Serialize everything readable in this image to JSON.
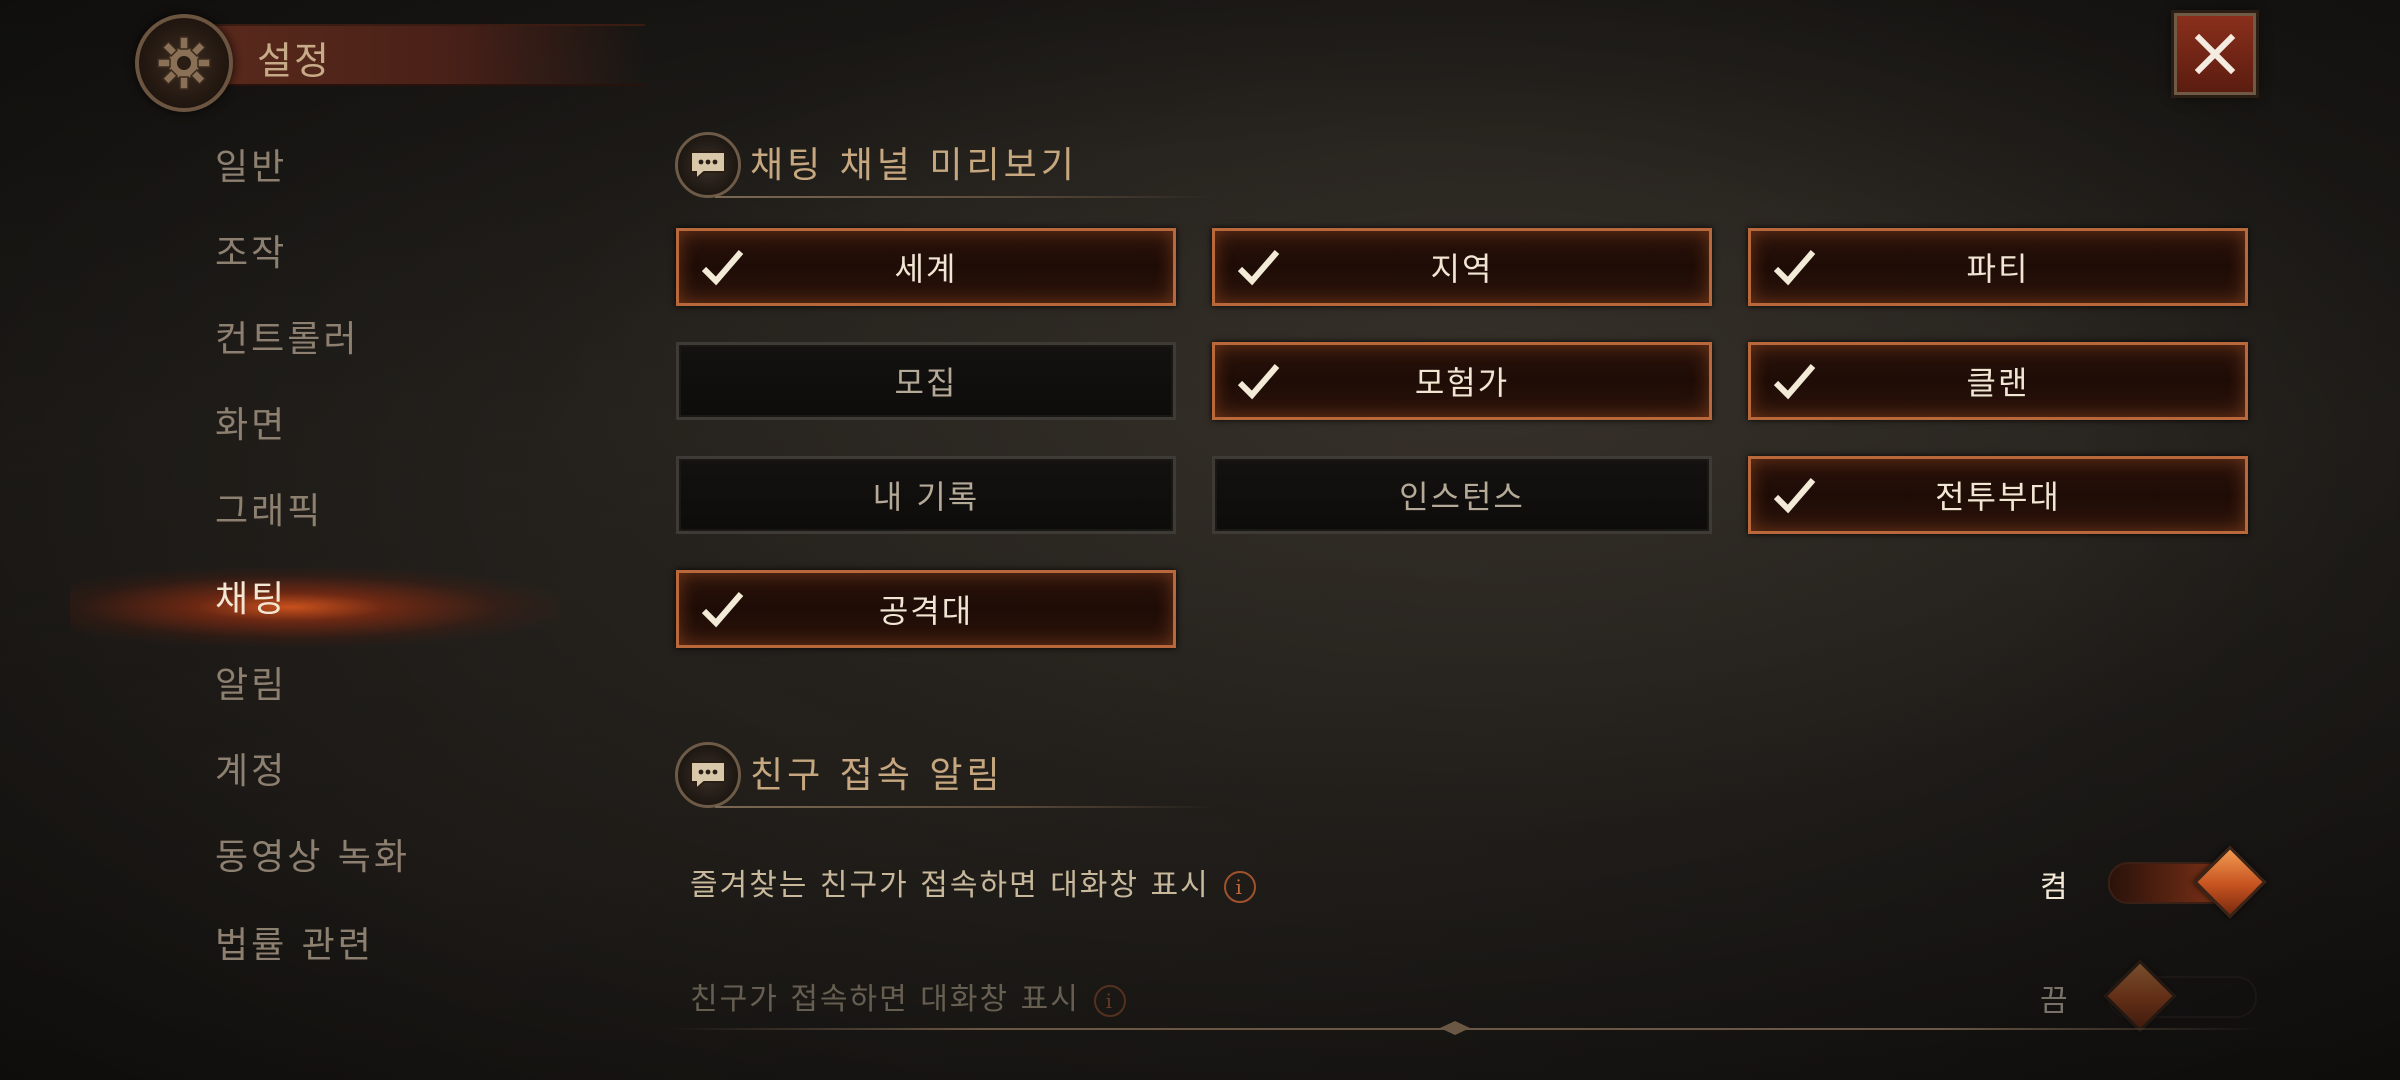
{
  "header": {
    "title": "설정"
  },
  "sidebar": {
    "items": [
      {
        "label": "일반",
        "active": false
      },
      {
        "label": "조작",
        "active": false
      },
      {
        "label": "컨트롤러",
        "active": false
      },
      {
        "label": "화면",
        "active": false
      },
      {
        "label": "그래픽",
        "active": false
      },
      {
        "label": "채팅",
        "active": true
      },
      {
        "label": "알림",
        "active": false
      },
      {
        "label": "계정",
        "active": false
      },
      {
        "label": "동영상 녹화",
        "active": false
      },
      {
        "label": "법률 관련",
        "active": false
      }
    ]
  },
  "chat_preview": {
    "title": "채팅 채널 미리보기",
    "channels": [
      {
        "label": "세계",
        "checked": true
      },
      {
        "label": "지역",
        "checked": true
      },
      {
        "label": "파티",
        "checked": true
      },
      {
        "label": "모집",
        "checked": false
      },
      {
        "label": "모험가",
        "checked": true
      },
      {
        "label": "클랜",
        "checked": true
      },
      {
        "label": "내 기록",
        "checked": false
      },
      {
        "label": "인스턴스",
        "checked": false
      },
      {
        "label": "전투부대",
        "checked": true
      },
      {
        "label": "공격대",
        "checked": true
      }
    ]
  },
  "friend_alert": {
    "title": "친구 접속 알림",
    "rows": [
      {
        "label": "즐겨찾는 친구가 접속하면 대화창 표시",
        "info_icon": "i",
        "state": "켬",
        "on": true
      },
      {
        "label": "친구가 접속하면 대화창 표시",
        "info_icon": "i",
        "state": "끔",
        "on": false
      }
    ]
  },
  "icons": {
    "header": "gear-icon",
    "close": "close-icon",
    "section": "chat-bubble-icon",
    "check": "checkmark-icon",
    "info": "info-icon"
  },
  "colors": {
    "accent": "#b8683a",
    "active_glow": "#e65a1e",
    "close_bg": "#8a2f1c"
  }
}
